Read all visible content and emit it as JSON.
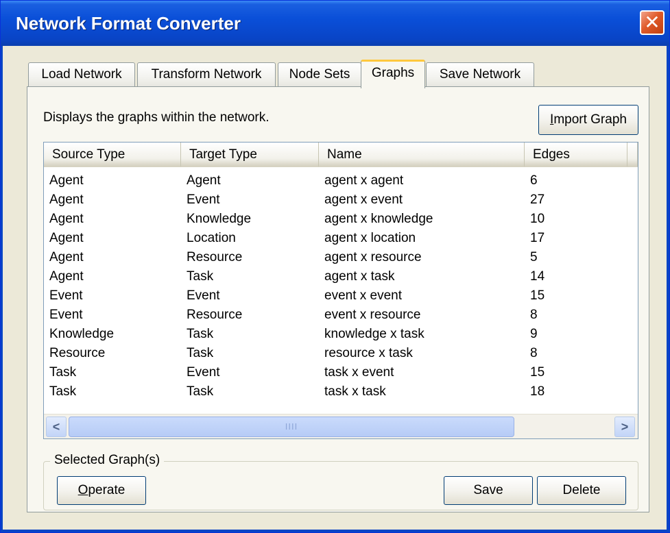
{
  "window": {
    "title": "Network Format Converter",
    "close_symbol": "✕"
  },
  "tabs": [
    {
      "label": "Load Network"
    },
    {
      "label": "Transform Network"
    },
    {
      "label": "Node Sets"
    },
    {
      "label": "Graphs",
      "active": true
    },
    {
      "label": "Save Network"
    }
  ],
  "graphs_panel": {
    "description": "Displays the graphs within the network.",
    "import_button": {
      "prefix": "",
      "mnemonic": "I",
      "suffix": "mport Graph"
    },
    "columns": [
      "Source Type",
      "Target Type",
      "Name",
      "Edges",
      ""
    ],
    "rows": [
      [
        "Agent",
        "Agent",
        "agent x agent",
        "6"
      ],
      [
        "Agent",
        "Event",
        "agent x event",
        "27"
      ],
      [
        "Agent",
        "Knowledge",
        "agent x knowledge",
        "10"
      ],
      [
        "Agent",
        "Location",
        "agent x location",
        "17"
      ],
      [
        "Agent",
        "Resource",
        "agent x resource",
        "5"
      ],
      [
        "Agent",
        "Task",
        "agent x task",
        "14"
      ],
      [
        "Event",
        "Event",
        "event x event",
        "15"
      ],
      [
        "Event",
        "Resource",
        "event x resource",
        "8"
      ],
      [
        "Knowledge",
        "Task",
        "knowledge x task",
        "9"
      ],
      [
        "Resource",
        "Task",
        "resource x task",
        "8"
      ],
      [
        "Task",
        "Event",
        "task x event",
        "15"
      ],
      [
        "Task",
        "Task",
        "task x task",
        "18"
      ]
    ],
    "scrollbar": {
      "left_arrow": "<",
      "right_arrow": ">",
      "grip": "IIII"
    }
  },
  "selected_graphs": {
    "label": "Selected Graph(s)",
    "operate_button": {
      "mnemonic": "O",
      "suffix": "perate"
    },
    "save_label": "Save",
    "delete_label": "Delete"
  }
}
